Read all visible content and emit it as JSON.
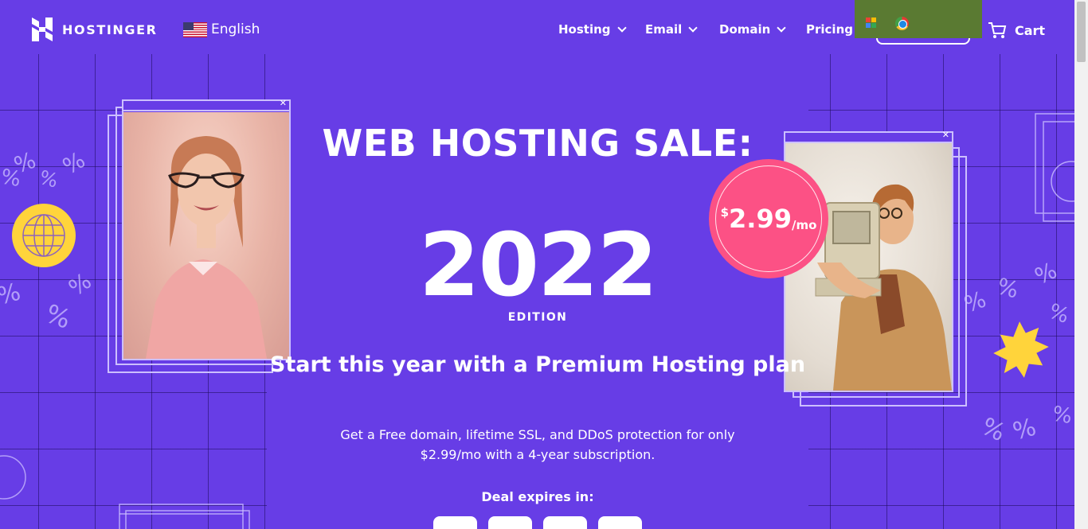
{
  "header": {
    "logo_text": "HOSTINGER",
    "language": "English",
    "nav": [
      {
        "label": "Hosting",
        "has_dropdown": true
      },
      {
        "label": "Email",
        "has_dropdown": true
      },
      {
        "label": "Domain",
        "has_dropdown": true
      },
      {
        "label": "Pricing",
        "has_dropdown": false
      }
    ],
    "cart_label": "Cart"
  },
  "hero": {
    "title": "WEB HOSTING SALE:",
    "year": "2022",
    "edition": "EDITION",
    "subtitle": "Start this year with a Premium Hosting plan",
    "description": "Get a Free domain, lifetime SSL, and DDoS protection for only $2.99/mo with a 4-year subscription.",
    "deal_label": "Deal expires in:"
  },
  "price_badge": {
    "currency": "$",
    "amount": "2.99",
    "period": "/mo"
  },
  "colors": {
    "background": "#673de6",
    "badge": "#fc5185",
    "accent_yellow": "#ffd43b",
    "extension_popup": "#5a7a32"
  },
  "icons": [
    "hostinger-logo-icon",
    "us-flag-icon",
    "chevron-down-icon",
    "cart-icon",
    "globe-icon",
    "starburst-icon",
    "percent-icon"
  ]
}
